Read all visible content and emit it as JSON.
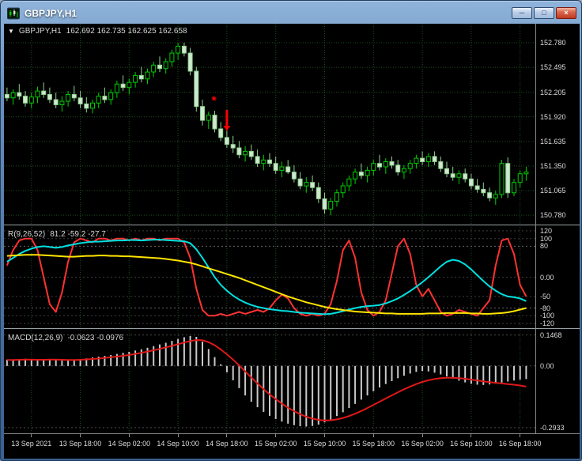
{
  "window": {
    "title": "GBPJPY,H1",
    "controls": [
      {
        "name": "minimize",
        "glyph": "─"
      },
      {
        "name": "maximize",
        "glyph": "□"
      },
      {
        "name": "close",
        "glyph": "×"
      }
    ]
  },
  "main_header": {
    "collapse_icon": "▼",
    "symbol_period": "GBPJPY,H1",
    "ohlc": "162.692 162.735 162.625 162.658"
  },
  "colors": {
    "grid": "#1d4f1d",
    "candle_up": "#00cf00",
    "candle_down_stroke": "#8fd08f",
    "candle_down_fill": "#cfe9cf",
    "annotation": "#ff0000",
    "axis_text": "#dcdcdc"
  },
  "chart_data": [
    {
      "type": "candlestick",
      "title": "GBPJPY,H1",
      "ylim": [
        150.68,
        153.0
      ],
      "y_ticks": [
        "152.780",
        "152.495",
        "152.205",
        "151.920",
        "151.635",
        "151.350",
        "151.065",
        "150.780"
      ],
      "x_ticks": [
        {
          "label": "13 Sep 2021",
          "bar": 4
        },
        {
          "label": "13 Sep 18:00",
          "bar": 12
        },
        {
          "label": "14 Sep 02:00",
          "bar": 20
        },
        {
          "label": "14 Sep 10:00",
          "bar": 28
        },
        {
          "label": "14 Sep 18:00",
          "bar": 36
        },
        {
          "label": "15 Sep 02:00",
          "bar": 44
        },
        {
          "label": "15 Sep 10:00",
          "bar": 52
        },
        {
          "label": "15 Sep 18:00",
          "bar": 60
        },
        {
          "label": "16 Sep 02:00",
          "bar": 68
        },
        {
          "label": "16 Sep 10:00",
          "bar": 76
        },
        {
          "label": "16 Sep 18:00",
          "bar": 84
        }
      ],
      "candles": [
        [
          152.18,
          152.26,
          152.1,
          152.14
        ],
        [
          152.14,
          152.24,
          152.06,
          152.2
        ],
        [
          152.2,
          152.3,
          152.12,
          152.16
        ],
        [
          152.16,
          152.22,
          152.04,
          152.08
        ],
        [
          152.08,
          152.2,
          152.02,
          152.15
        ],
        [
          152.15,
          152.27,
          152.08,
          152.22
        ],
        [
          152.22,
          152.32,
          152.14,
          152.18
        ],
        [
          152.18,
          152.26,
          152.08,
          152.12
        ],
        [
          152.12,
          152.2,
          152.02,
          152.06
        ],
        [
          152.06,
          152.16,
          151.98,
          152.1
        ],
        [
          152.1,
          152.22,
          152.04,
          152.18
        ],
        [
          152.18,
          152.28,
          152.1,
          152.14
        ],
        [
          152.14,
          152.22,
          152.02,
          152.07
        ],
        [
          152.07,
          152.15,
          151.97,
          152.02
        ],
        [
          152.02,
          152.12,
          151.96,
          152.08
        ],
        [
          152.08,
          152.2,
          152.02,
          152.16
        ],
        [
          152.16,
          152.26,
          152.08,
          152.12
        ],
        [
          152.12,
          152.24,
          152.06,
          152.2
        ],
        [
          152.2,
          152.34,
          152.14,
          152.3
        ],
        [
          152.3,
          152.4,
          152.22,
          152.26
        ],
        [
          152.26,
          152.36,
          152.18,
          152.32
        ],
        [
          152.32,
          152.44,
          152.26,
          152.4
        ],
        [
          152.4,
          152.5,
          152.32,
          152.36
        ],
        [
          152.36,
          152.48,
          152.3,
          152.44
        ],
        [
          152.44,
          152.56,
          152.38,
          152.52
        ],
        [
          152.52,
          152.62,
          152.44,
          152.48
        ],
        [
          152.48,
          152.6,
          152.42,
          152.56
        ],
        [
          152.56,
          152.7,
          152.5,
          152.66
        ],
        [
          152.66,
          152.78,
          152.58,
          152.74
        ],
        [
          152.74,
          152.78,
          152.62,
          152.66
        ],
        [
          152.66,
          152.72,
          152.4,
          152.45
        ],
        [
          152.45,
          152.5,
          151.98,
          152.04
        ],
        [
          152.04,
          152.12,
          151.82,
          151.88
        ],
        [
          151.88,
          151.98,
          151.78,
          151.94
        ],
        [
          151.94,
          151.99,
          151.74,
          151.78
        ],
        [
          151.78,
          151.86,
          151.64,
          151.68
        ],
        [
          151.68,
          151.76,
          151.56,
          151.6
        ],
        [
          151.6,
          151.7,
          151.5,
          151.56
        ],
        [
          151.56,
          151.64,
          151.44,
          151.48
        ],
        [
          151.48,
          151.58,
          151.4,
          151.52
        ],
        [
          151.52,
          151.6,
          151.42,
          151.46
        ],
        [
          151.46,
          151.54,
          151.34,
          151.38
        ],
        [
          151.38,
          151.48,
          151.3,
          151.42
        ],
        [
          151.42,
          151.5,
          151.34,
          151.38
        ],
        [
          151.38,
          151.46,
          151.26,
          151.3
        ],
        [
          151.3,
          151.4,
          151.22,
          151.34
        ],
        [
          151.34,
          151.42,
          151.26,
          151.28
        ],
        [
          151.28,
          151.36,
          151.16,
          151.2
        ],
        [
          151.2,
          151.28,
          151.08,
          151.12
        ],
        [
          151.12,
          151.22,
          151.04,
          151.16
        ],
        [
          151.16,
          151.24,
          151.06,
          151.1
        ],
        [
          151.1,
          151.16,
          150.92,
          150.97
        ],
        [
          150.97,
          151.04,
          150.8,
          150.85
        ],
        [
          150.85,
          150.98,
          150.78,
          150.94
        ],
        [
          150.94,
          151.08,
          150.88,
          151.04
        ],
        [
          151.04,
          151.16,
          150.98,
          151.12
        ],
        [
          151.12,
          151.24,
          151.06,
          151.2
        ],
        [
          151.2,
          151.32,
          151.14,
          151.28
        ],
        [
          151.28,
          151.38,
          151.2,
          151.24
        ],
        [
          151.24,
          151.34,
          151.16,
          151.3
        ],
        [
          151.3,
          151.42,
          151.24,
          151.38
        ],
        [
          151.38,
          151.48,
          151.3,
          151.34
        ],
        [
          151.34,
          151.44,
          151.26,
          151.4
        ],
        [
          151.4,
          151.46,
          151.32,
          151.36
        ],
        [
          151.36,
          151.42,
          151.24,
          151.28
        ],
        [
          151.28,
          151.36,
          151.2,
          151.32
        ],
        [
          151.32,
          151.42,
          151.26,
          151.38
        ],
        [
          151.38,
          151.48,
          151.32,
          151.44
        ],
        [
          151.44,
          151.52,
          151.36,
          151.4
        ],
        [
          151.4,
          151.5,
          151.34,
          151.46
        ],
        [
          151.46,
          151.52,
          151.36,
          151.4
        ],
        [
          151.4,
          151.46,
          151.28,
          151.32
        ],
        [
          151.32,
          151.4,
          151.22,
          151.26
        ],
        [
          151.26,
          151.34,
          151.18,
          151.22
        ],
        [
          151.22,
          151.3,
          151.14,
          151.26
        ],
        [
          151.26,
          151.32,
          151.16,
          151.2
        ],
        [
          151.2,
          151.26,
          151.08,
          151.12
        ],
        [
          151.12,
          151.2,
          151.04,
          151.08
        ],
        [
          151.08,
          151.16,
          151.0,
          151.04
        ],
        [
          151.04,
          151.1,
          150.94,
          150.98
        ],
        [
          150.98,
          151.06,
          150.9,
          151.02
        ],
        [
          151.02,
          151.42,
          150.98,
          151.38
        ],
        [
          151.38,
          151.45,
          150.98,
          151.04
        ],
        [
          151.04,
          151.2,
          151.0,
          151.16
        ],
        [
          151.16,
          151.3,
          151.1,
          151.26
        ],
        [
          151.26,
          151.34,
          151.18,
          151.28
        ]
      ],
      "annotations": [
        {
          "type": "star",
          "text": "*",
          "bar": 34,
          "price": 152.06
        },
        {
          "type": "arrow_down",
          "bar": 36,
          "from_price": 152.0,
          "to_price": 151.76
        }
      ]
    },
    {
      "type": "line",
      "title": "R(9,26,52)",
      "values_text": "81.2 -59.2 -27.7",
      "ylim": [
        -130,
        130
      ],
      "y_ticks": [
        "120",
        "100",
        "80",
        "0.00",
        "-50",
        "-80",
        "-100",
        "-120"
      ],
      "series": [
        {
          "name": "fast",
          "color": "#ff3232",
          "values": [
            30,
            70,
            95,
            100,
            100,
            70,
            0,
            -70,
            -90,
            -40,
            40,
            90,
            100,
            95,
            90,
            100,
            100,
            95,
            100,
            100,
            95,
            100,
            95,
            100,
            100,
            95,
            100,
            100,
            100,
            90,
            50,
            -30,
            -85,
            -100,
            -100,
            -95,
            -100,
            -95,
            -90,
            -95,
            -90,
            -85,
            -90,
            -80,
            -60,
            -45,
            -55,
            -80,
            -95,
            -100,
            -95,
            -100,
            -95,
            -70,
            -10,
            70,
            95,
            50,
            -40,
            -85,
            -100,
            -90,
            -60,
            10,
            80,
            100,
            60,
            -20,
            -50,
            -30,
            -60,
            -90,
            -100,
            -95,
            -85,
            -90,
            -95,
            -100,
            -80,
            -60,
            30,
            95,
            100,
            60,
            -20,
            -50
          ]
        },
        {
          "name": "mid",
          "color": "#00e0e0",
          "values": [
            40,
            50,
            60,
            68,
            74,
            78,
            80,
            78,
            76,
            78,
            82,
            85,
            88,
            90,
            92,
            92,
            93,
            94,
            95,
            95,
            96,
            96,
            95,
            96,
            97,
            97,
            96,
            95,
            94,
            93,
            88,
            72,
            50,
            25,
            0,
            -20,
            -35,
            -48,
            -58,
            -66,
            -72,
            -77,
            -80,
            -83,
            -85,
            -87,
            -88,
            -90,
            -92,
            -93,
            -94,
            -95,
            -96,
            -95,
            -92,
            -88,
            -84,
            -80,
            -77,
            -75,
            -74,
            -72,
            -68,
            -62,
            -55,
            -46,
            -36,
            -25,
            -13,
            0,
            14,
            28,
            40,
            45,
            42,
            33,
            20,
            5,
            -10,
            -24,
            -35,
            -44,
            -50,
            -52,
            -55,
            -62
          ]
        },
        {
          "name": "slow",
          "color": "#ffe400",
          "values": [
            55,
            56,
            57,
            58,
            58,
            58,
            57,
            56,
            55,
            54,
            53,
            53,
            54,
            55,
            55,
            56,
            56,
            55,
            55,
            54,
            54,
            53,
            52,
            51,
            50,
            49,
            47,
            45,
            43,
            40,
            37,
            33,
            28,
            23,
            18,
            13,
            8,
            3,
            -2,
            -8,
            -14,
            -20,
            -26,
            -32,
            -38,
            -44,
            -50,
            -55,
            -60,
            -65,
            -69,
            -73,
            -77,
            -80,
            -83,
            -85,
            -87,
            -89,
            -90,
            -91,
            -92,
            -93,
            -94,
            -94,
            -95,
            -95,
            -95,
            -95,
            -95,
            -94,
            -94,
            -94,
            -93,
            -93,
            -93,
            -93,
            -94,
            -94,
            -95,
            -95,
            -94,
            -93,
            -91,
            -88,
            -84,
            -80
          ]
        }
      ]
    },
    {
      "type": "bar",
      "title": "MACD(12,26,9)",
      "values_text": "-0.0623 -0.0976",
      "ylim": [
        -0.32,
        0.168
      ],
      "y_ticks": [
        "0.1468",
        "0.00",
        "-0.2933"
      ],
      "histogram": {
        "color": "#c8c8c8",
        "values": [
          0.03,
          0.028,
          0.032,
          0.034,
          0.03,
          0.027,
          0.029,
          0.032,
          0.028,
          0.025,
          0.027,
          0.03,
          0.033,
          0.036,
          0.04,
          0.044,
          0.048,
          0.052,
          0.057,
          0.062,
          0.067,
          0.073,
          0.079,
          0.086,
          0.094,
          0.102,
          0.11,
          0.119,
          0.128,
          0.136,
          0.142,
          0.138,
          0.115,
          0.08,
          0.042,
          0.008,
          -0.03,
          -0.068,
          -0.105,
          -0.14,
          -0.17,
          -0.196,
          -0.218,
          -0.237,
          -0.252,
          -0.264,
          -0.274,
          -0.281,
          -0.286,
          -0.288,
          -0.285,
          -0.278,
          -0.268,
          -0.254,
          -0.238,
          -0.22,
          -0.2,
          -0.18,
          -0.16,
          -0.14,
          -0.12,
          -0.102,
          -0.086,
          -0.072,
          -0.058,
          -0.046,
          -0.036,
          -0.028,
          -0.024,
          -0.026,
          -0.032,
          -0.04,
          -0.05,
          -0.06,
          -0.07,
          -0.078,
          -0.085,
          -0.089,
          -0.09,
          -0.088,
          -0.084,
          -0.079,
          -0.074,
          -0.069,
          -0.065,
          -0.062
        ]
      },
      "signal": {
        "color": "#e01818",
        "values": [
          0.028,
          0.028,
          0.029,
          0.03,
          0.03,
          0.029,
          0.029,
          0.03,
          0.03,
          0.029,
          0.028,
          0.028,
          0.029,
          0.031,
          0.033,
          0.035,
          0.038,
          0.041,
          0.044,
          0.048,
          0.052,
          0.057,
          0.062,
          0.068,
          0.074,
          0.081,
          0.088,
          0.095,
          0.103,
          0.111,
          0.118,
          0.123,
          0.122,
          0.113,
          0.098,
          0.078,
          0.055,
          0.03,
          0.003,
          -0.026,
          -0.055,
          -0.083,
          -0.11,
          -0.135,
          -0.158,
          -0.179,
          -0.198,
          -0.215,
          -0.229,
          -0.241,
          -0.25,
          -0.256,
          -0.259,
          -0.258,
          -0.254,
          -0.247,
          -0.238,
          -0.227,
          -0.214,
          -0.2,
          -0.185,
          -0.17,
          -0.155,
          -0.14,
          -0.125,
          -0.111,
          -0.098,
          -0.086,
          -0.076,
          -0.068,
          -0.062,
          -0.058,
          -0.056,
          -0.056,
          -0.058,
          -0.061,
          -0.065,
          -0.069,
          -0.073,
          -0.077,
          -0.08,
          -0.083,
          -0.086,
          -0.089,
          -0.093,
          -0.098
        ]
      }
    }
  ]
}
